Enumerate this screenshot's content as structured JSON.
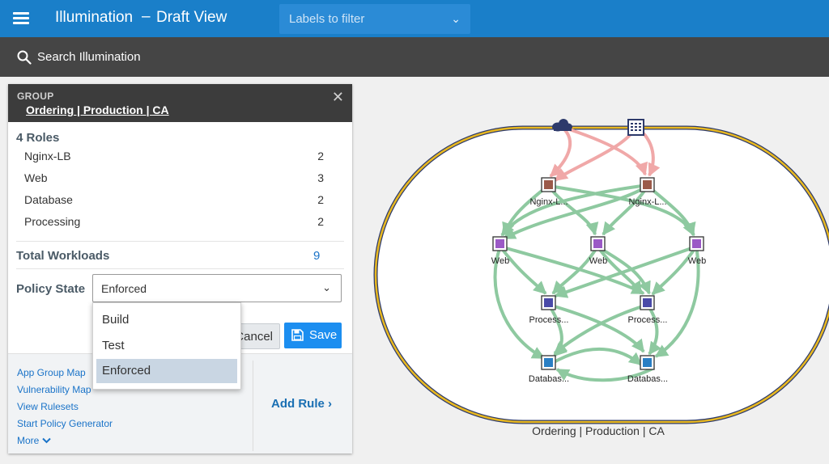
{
  "header": {
    "app_title": "Illumination",
    "separator": "–",
    "view_title": "Draft View",
    "label_filter_placeholder": "Labels to filter",
    "menu_icon": "hamburger-menu-icon"
  },
  "search": {
    "label": "Search Illumination",
    "icon": "search-icon"
  },
  "panel": {
    "kicker": "GROUP",
    "group_name": "Ordering | Production | CA",
    "roles_title": "4 Roles",
    "roles": [
      {
        "name": "Nginx-LB",
        "count": "2"
      },
      {
        "name": "Web",
        "count": "3"
      },
      {
        "name": "Database",
        "count": "2"
      },
      {
        "name": "Processing",
        "count": "2"
      }
    ],
    "total_label": "Total Workloads",
    "total_value": "9",
    "policy_label": "Policy State",
    "policy_value": "Enforced",
    "cancel_label": "Cancel",
    "save_label": "Save",
    "links": [
      "App Group Map",
      "Vulnerability Map",
      "View Rulesets",
      "Start Policy Generator",
      "More"
    ],
    "add_rule_label": "Add Rule",
    "add_rule_chevron": "›"
  },
  "policy_dropdown": {
    "options": [
      "Build",
      "Test",
      "Enforced"
    ],
    "selected": "Enforced"
  },
  "map": {
    "group_caption": "Ordering | Production | CA",
    "nodes": [
      {
        "id": "nginx1",
        "label": "Nginx-L...",
        "color": "#9b5a4a"
      },
      {
        "id": "nginx2",
        "label": "Nginx-L...",
        "color": "#9b5a4a"
      },
      {
        "id": "web1",
        "label": "Web",
        "color": "#9b59c6"
      },
      {
        "id": "web2",
        "label": "Web",
        "color": "#9b59c6"
      },
      {
        "id": "web3",
        "label": "Web",
        "color": "#9b59c6"
      },
      {
        "id": "proc1",
        "label": "Process...",
        "color": "#4a4aa8"
      },
      {
        "id": "proc2",
        "label": "Process...",
        "color": "#4a4aa8"
      },
      {
        "id": "db1",
        "label": "Databas...",
        "color": "#2a7fc4"
      },
      {
        "id": "db2",
        "label": "Databas...",
        "color": "#2a7fc4"
      }
    ],
    "colors": {
      "group_border": "#e8b820",
      "group_inner_border": "#2d3a6b",
      "internet_edge": "#f0a8a8",
      "internal_edge": "#8ec9a0",
      "internet_icon": "#2d3a6b"
    },
    "icons": [
      "internet-cloud-icon",
      "ip-list-icon"
    ]
  }
}
